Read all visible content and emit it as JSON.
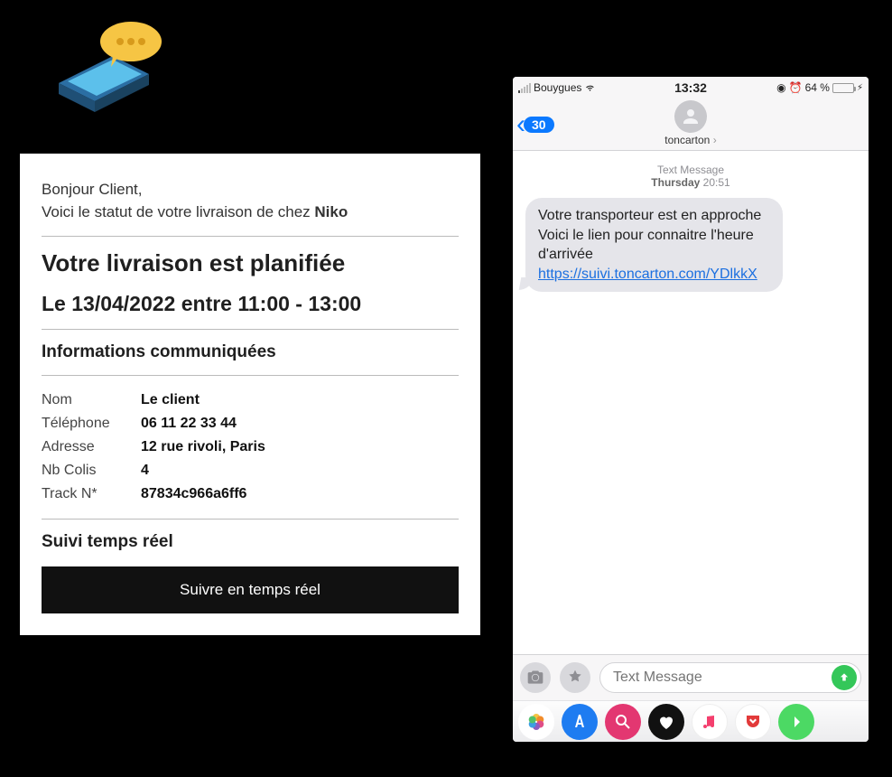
{
  "email": {
    "greeting_line1": "Bonjour Client,",
    "greeting_line2_prefix": "Voici le statut de votre livraison de chez ",
    "brand": "Niko",
    "title": "Votre livraison est planifiée",
    "schedule": "Le 13/04/2022 entre 11:00 - 13:00",
    "info_heading": "Informations communiquées",
    "info": {
      "name_label": "Nom",
      "name_value": "Le client",
      "phone_label": "Téléphone",
      "phone_value": "06 11 22 33 44",
      "address_label": "Adresse",
      "address_value": "12 rue rivoli, Paris",
      "parcels_label": "Nb Colis",
      "parcels_value": "4",
      "track_label": "Track N*",
      "track_value": "87834c966a6ff6"
    },
    "realtime_heading": "Suivi temps réel",
    "cta_label": "Suivre en temps réel"
  },
  "phone": {
    "statusbar": {
      "carrier": "Bouygues",
      "time": "13:32",
      "battery_pct": "64 %"
    },
    "nav": {
      "back_count": "30",
      "contact_name": "toncarton"
    },
    "thread": {
      "timestamp_label": "Text Message",
      "timestamp_day": "Thursday",
      "timestamp_time": "20:51",
      "message_line1": "Votre transporteur est en approche",
      "message_line2": "Voici le lien pour connaitre l'heure d'arrivée",
      "message_link": "https://suivi.toncarton.com/YDlkkX"
    },
    "composer": {
      "placeholder": "Text Message"
    }
  }
}
